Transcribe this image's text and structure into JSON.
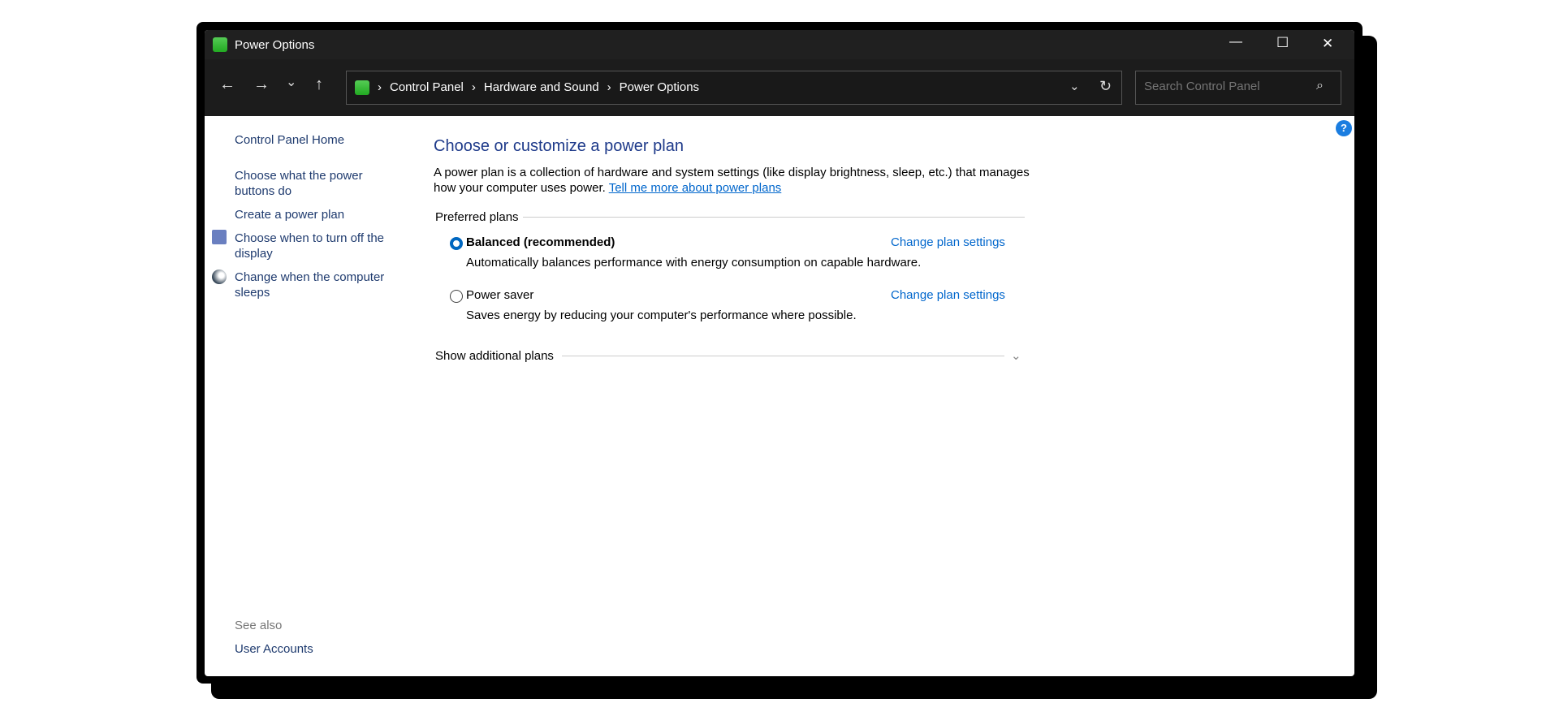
{
  "window": {
    "title": "Power Options",
    "minimize": "—",
    "maximize": "☐",
    "close": "✕"
  },
  "nav": {
    "back": "←",
    "forward": "→",
    "recent": "⌄",
    "up": "↑",
    "refresh": "↻",
    "dropdown": "⌄"
  },
  "breadcrumb": [
    "Control Panel",
    "Hardware and Sound",
    "Power Options"
  ],
  "search": {
    "placeholder": "Search Control Panel"
  },
  "help": "?",
  "sidebar": {
    "items": [
      "Control Panel Home",
      "Choose what the power buttons do",
      "Create a power plan",
      "Choose when to turn off the display",
      "Change when the computer sleeps"
    ],
    "see_also": "See also",
    "see_also_items": [
      "User Accounts"
    ]
  },
  "main": {
    "title": "Choose or customize a power plan",
    "description": "A power plan is a collection of hardware and system settings (like display brightness, sleep, etc.) that manages how your computer uses power.",
    "learn_more": "Tell me more about power plans",
    "preferred_label": "Preferred plans",
    "plans": [
      {
        "name": "Balanced (recommended)",
        "desc": "Automatically balances performance with energy consumption on capable hardware.",
        "link": "Change plan settings",
        "selected": true
      },
      {
        "name": "Power saver",
        "desc": "Saves energy by reducing your computer's performance where possible.",
        "link": "Change plan settings",
        "selected": false
      }
    ],
    "additional": "Show additional plans"
  }
}
